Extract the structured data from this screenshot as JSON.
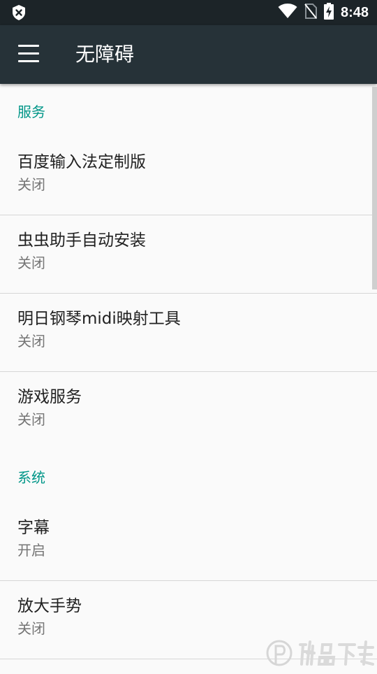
{
  "status_bar": {
    "time": "8:48"
  },
  "app_bar": {
    "title": "无障碍"
  },
  "sections": {
    "services": {
      "header": "服务",
      "items": [
        {
          "title": "百度输入法定制版",
          "summary": "关闭"
        },
        {
          "title": "虫虫助手自动安装",
          "summary": "关闭"
        },
        {
          "title": "明日钢琴midi映射工具",
          "summary": "关闭"
        },
        {
          "title": "游戏服务",
          "summary": "关闭"
        }
      ]
    },
    "system": {
      "header": "系统",
      "items": [
        {
          "title": "字幕",
          "summary": "开启"
        },
        {
          "title": "放大手势",
          "summary": "关闭"
        }
      ]
    }
  },
  "colors": {
    "status_bar": "#1c2428",
    "app_bar": "#263238",
    "accent": "#009688",
    "background": "#fafafa"
  },
  "icons": [
    "shield-x-icon",
    "wifi-icon",
    "no-sim-icon",
    "battery-charging-icon",
    "menu-icon"
  ]
}
